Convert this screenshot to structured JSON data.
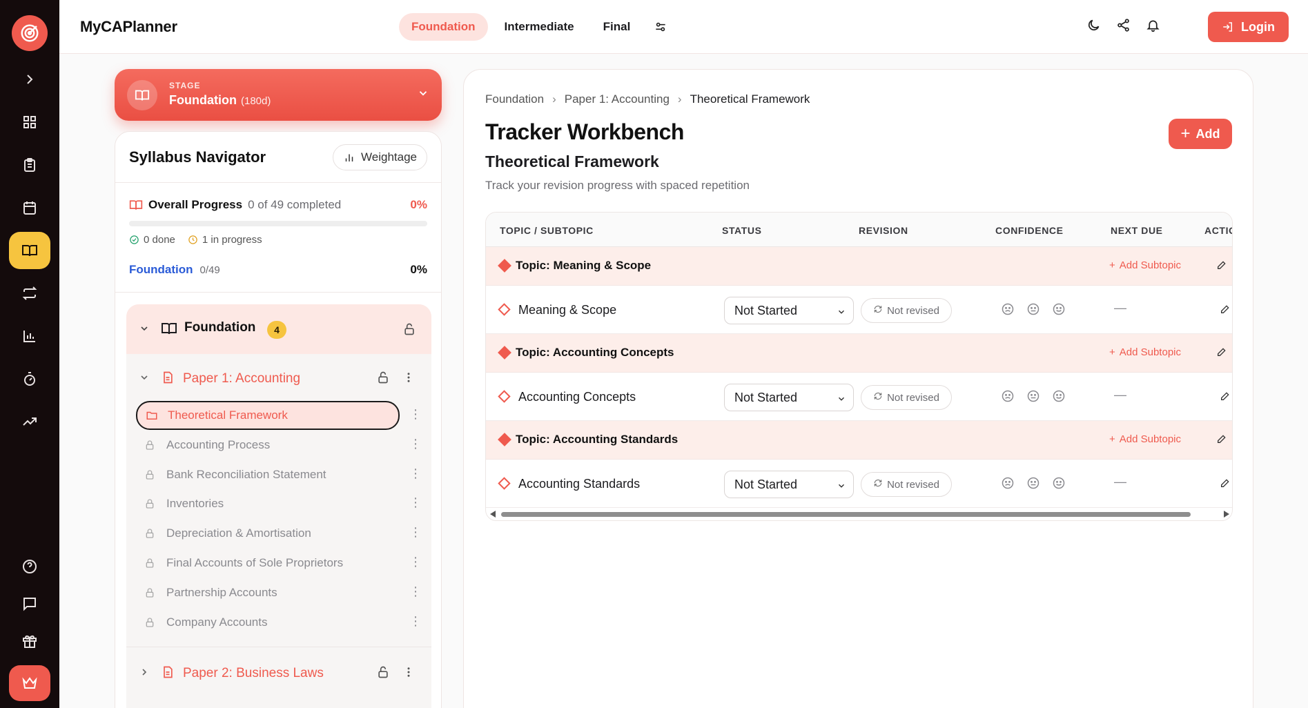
{
  "app": {
    "brand": "MyCAPlanner"
  },
  "header": {
    "tabs": [
      {
        "label": "Foundation",
        "active": true
      },
      {
        "label": "Intermediate",
        "active": false
      },
      {
        "label": "Final",
        "active": false
      }
    ],
    "login_label": "Login"
  },
  "rail": {
    "items": [
      "expand-icon",
      "dashboard-icon",
      "clipboard-icon",
      "calendar-icon",
      "book-icon",
      "repeat-icon",
      "bar-chart-icon",
      "timer-icon",
      "trending-up-icon"
    ],
    "active_item": "book-icon",
    "bottom_items": [
      "help-icon",
      "chat-icon",
      "gift-icon",
      "crown-icon"
    ]
  },
  "stage": {
    "label": "STAGE",
    "name": "Foundation",
    "days": "(180d)"
  },
  "syllabus": {
    "title": "Syllabus Navigator",
    "weightage_label": "Weightage",
    "overall_label": "Overall Progress",
    "overall_text": "0 of 49 completed",
    "overall_pct": "0%",
    "overall_fraction": 0,
    "done_text": "0 done",
    "in_progress_text": "1 in progress",
    "level_name": "Foundation",
    "level_count": "0/49",
    "level_pct": "0%",
    "group": {
      "name": "Foundation",
      "badge": "4"
    },
    "papers": [
      {
        "name": "Paper 1: Accounting",
        "expanded": true
      },
      {
        "name": "Paper 2: Business Laws",
        "expanded": false
      }
    ],
    "chapters": [
      {
        "name": "Theoretical Framework",
        "active": true
      },
      {
        "name": "Accounting Process"
      },
      {
        "name": "Bank Reconciliation Statement"
      },
      {
        "name": "Inventories"
      },
      {
        "name": "Depreciation & Amortisation"
      },
      {
        "name": "Final Accounts of Sole Proprietors"
      },
      {
        "name": "Partnership Accounts"
      },
      {
        "name": "Company Accounts"
      }
    ]
  },
  "main": {
    "breadcrumb": [
      "Foundation",
      "Paper 1: Accounting",
      "Theoretical Framework"
    ],
    "title": "Tracker Workbench",
    "subtitle": "Theoretical Framework",
    "description": "Track your revision progress with spaced repetition",
    "add_label": "Add",
    "columns": [
      "TOPIC / SUBTOPIC",
      "STATUS",
      "REVISION",
      "CONFIDENCE",
      "NEXT DUE",
      "ACTIO"
    ],
    "add_subtopic_label": "Add Subtopic",
    "rows": [
      {
        "topic": "Topic: Meaning & Scope",
        "subtopic": "Meaning & Scope",
        "status": "Not Started",
        "revision": "Not revised",
        "next_due": "—"
      },
      {
        "topic": "Topic: Accounting Concepts",
        "subtopic": "Accounting Concepts",
        "status": "Not Started",
        "revision": "Not revised",
        "next_due": "—"
      },
      {
        "topic": "Topic: Accounting Standards",
        "subtopic": "Accounting Standards",
        "status": "Not Started",
        "revision": "Not revised",
        "next_due": "—"
      }
    ]
  },
  "colors": {
    "accent": "#ef5a4e",
    "rail_bg": "#140b0c",
    "rail_active": "#f6c43f",
    "link": "#2a5bd7"
  }
}
